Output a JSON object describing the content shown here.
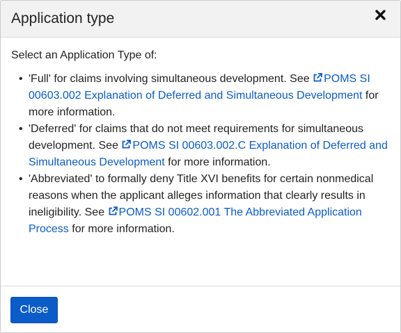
{
  "dialog": {
    "title": "Application type",
    "close_icon": "close-x-icon",
    "intro": "Select an Application Type of:",
    "items": [
      {
        "lead": "'Full' for claims involving simultaneous development. See ",
        "link_icon": "external-link-icon",
        "link_text": "POMS SI 00603.002 Explanation of Deferred and Simultaneous Development",
        "tail": " for more information."
      },
      {
        "lead": "'Deferred' for claims that do not meet requirements for simultaneous development. See ",
        "link_icon": "external-link-icon",
        "link_text": "POMS SI 00603.002.C Explanation of Deferred and Simultaneous Development",
        "tail": " for more information."
      },
      {
        "lead": "'Abbreviated' to formally deny Title XVI benefits for certain nonmedical reasons when the applicant alleges information that clearly results in ineligibility. See ",
        "link_icon": "external-link-icon",
        "link_text": "POMS SI 00602.001 The Abbreviated Application Process",
        "tail": " for more information."
      }
    ],
    "footer": {
      "close_label": "Close"
    }
  },
  "colors": {
    "link": "#0b5cc9",
    "button": "#0b5cc9",
    "header_bg": "#f2f2f2"
  }
}
